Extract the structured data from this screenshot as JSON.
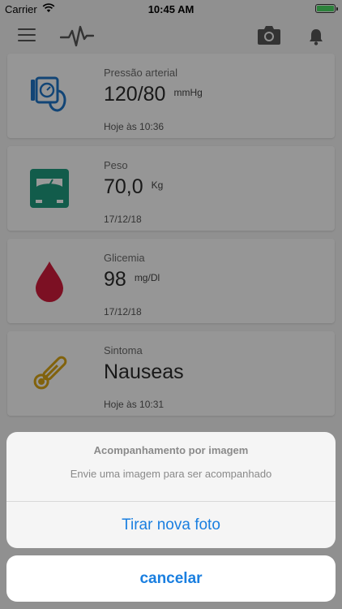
{
  "status": {
    "carrier": "Carrier",
    "time": "10:45 AM"
  },
  "cards": [
    {
      "label": "Pressão arterial",
      "value": "120/80",
      "unit": "mmHg",
      "date": "Hoje às 10:36",
      "icon": "blood-pressure-icon"
    },
    {
      "label": "Peso",
      "value": "70,0",
      "unit": "Kg",
      "date": "17/12/18",
      "icon": "scale-icon"
    },
    {
      "label": "Glicemia",
      "value": "98",
      "unit": "mg/Dl",
      "date": "17/12/18",
      "icon": "blood-drop-icon"
    },
    {
      "label": "Sintoma",
      "value": "Nauseas",
      "unit": "",
      "date": "Hoje às 10:31",
      "icon": "thermometer-icon"
    }
  ],
  "action_sheet": {
    "title": "Acompanhamento por imagem",
    "message": "Envie uma imagem para ser acompanhado",
    "action": "Tirar nova foto",
    "cancel": "cancelar"
  },
  "colors": {
    "accent": "#1a7fe0",
    "bp_icon": "#1f74c5",
    "scale_icon": "#1e9a7e",
    "drop_icon": "#cf1c3b",
    "thermo_icon": "#d7a414"
  }
}
